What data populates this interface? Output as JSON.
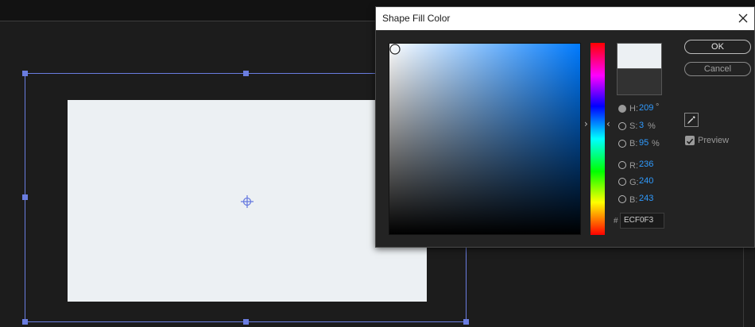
{
  "dialog": {
    "title": "Shape Fill Color",
    "ok_label": "OK",
    "cancel_label": "Cancel",
    "preview_label": "Preview",
    "preview_checked": true
  },
  "fields": {
    "h": {
      "label": "H:",
      "value": "209",
      "unit": "°"
    },
    "s": {
      "label": "S:",
      "value": "3",
      "unit": "%"
    },
    "b_hsb": {
      "label": "B:",
      "value": "95",
      "unit": "%"
    },
    "r": {
      "label": "R:",
      "value": "236"
    },
    "g": {
      "label": "G:",
      "value": "240"
    },
    "b_rgb": {
      "label": "B:",
      "value": "243"
    },
    "selected_mode": "H"
  },
  "hex": {
    "hash": "#",
    "value": "ECF0F3"
  },
  "colors": {
    "current": "#ecf0f3",
    "previous": "#323232",
    "selection_accent": "#6a7de0",
    "value_accent": "#2f9bff"
  },
  "icons": {
    "close": "close-icon",
    "eyedropper": "eyedropper-icon",
    "anchor": "anchor-point-icon",
    "picker_marker": "picker-circle-icon"
  }
}
